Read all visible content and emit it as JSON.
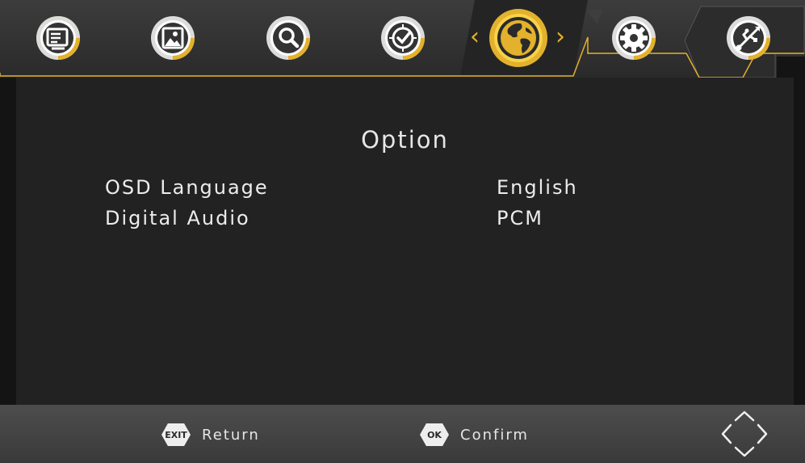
{
  "menu": {
    "items": [
      {
        "id": "program",
        "icon": "program-list-icon"
      },
      {
        "id": "picture",
        "icon": "picture-icon"
      },
      {
        "id": "search",
        "icon": "search-icon"
      },
      {
        "id": "time",
        "icon": "clock-icon"
      },
      {
        "id": "option",
        "icon": "globe-icon",
        "selected": true
      },
      {
        "id": "system",
        "icon": "gear-icon"
      },
      {
        "id": "usb",
        "icon": "usb-icon"
      }
    ],
    "prev_arrow": "‹",
    "next_arrow": "›"
  },
  "panel": {
    "title": "Option",
    "rows": [
      {
        "label": "OSD Language",
        "value": "English"
      },
      {
        "label": "Digital Audio",
        "value": "PCM"
      }
    ]
  },
  "footer": {
    "exit_badge": "EXIT",
    "exit_label": "Return",
    "ok_badge": "OK",
    "ok_label": "Confirm"
  },
  "colors": {
    "accent": "#e3b12b",
    "panel": "#222222",
    "text": "#ececec"
  }
}
